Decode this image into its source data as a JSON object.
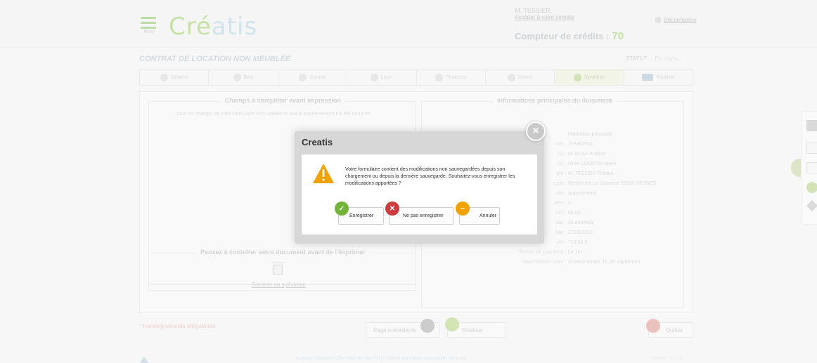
{
  "header": {
    "menu_label": "Menu",
    "logo_part1": "Cré",
    "logo_part2": "atis",
    "user_name": "M. TESSIER,",
    "account_link": "Accéder à votre compte",
    "logout_label": "Déconnexion",
    "credits_label": "Compteur de crédits :",
    "credits_value": "70"
  },
  "document": {
    "title": "CONTRAT DE LOCATION NON MEUBLÉE",
    "status_label": "STATUT",
    "status_value": "... En cours..."
  },
  "tabs": [
    {
      "label": "Général",
      "active": false
    },
    {
      "label": "Bien",
      "active": false
    },
    {
      "label": "Contrat",
      "active": false
    },
    {
      "label": "Loyer",
      "active": false
    },
    {
      "label": "Finances",
      "active": false
    },
    {
      "label": "Divers",
      "active": false
    },
    {
      "label": "Synthèse",
      "active": true
    },
    {
      "label": "Finaliser",
      "active": false
    }
  ],
  "left_panel": {
    "legend": "Champs à compléter avant impression",
    "note": "Tous les champs de votre formulaire sont valides et aucun avertissement n'a été remonté."
  },
  "print_panel": {
    "legend": "Pensez à contrôler votre document avant de l'imprimer",
    "specimen_label": "Spécimen",
    "generate_link": "Générer un spécimen"
  },
  "right_panel": {
    "legend": "Informations principales du document",
    "rows": [
      {
        "label": "",
        "value": "Habitation principale"
      },
      {
        "label": "ure :",
        "value": "27/08/2018"
      },
      {
        "label": "(s) :",
        "value": "M. RUAZ Arnaud"
      },
      {
        "label": "(s) :",
        "value": "Mme COURTIN Marie"
      },
      {
        "label": "ant :",
        "value": "M. TESSIER Thibaut"
      },
      {
        "label": "esse :",
        "value": "Résidence La Cézanne 35000 RENNES"
      },
      {
        "label": "ure :",
        "value": "Appartement"
      },
      {
        "label": "ales :",
        "value": "4"
      },
      {
        "label": "m²) :",
        "value": "65,00"
      },
      {
        "label": "bail :",
        "value": "36 année(s)"
      },
      {
        "label": "bail :",
        "value": "27/08/2018"
      },
      {
        "label": "yer :",
        "value": "710,00 €"
      },
      {
        "label": "Termes de paiement :",
        "value": "Le 1er"
      },
      {
        "label": "Date révision loyer :",
        "value": "Chaque année, le 1er septembre"
      }
    ]
  },
  "footer": {
    "required_note": "* Renseignements obligatoires",
    "prev_label": "Page précédente",
    "next_label": "Finaliser",
    "quit_label": "Quitter",
    "links": "A propos | Contacts | CGV | Plan du site | FAQ | Tableau des indices | Documents mis à jour",
    "version": "Version : 3.2.15"
  },
  "modal": {
    "title": "Creatis",
    "message": "Votre formulaire contient des modifications non sauvegardées depuis son chargement ou depuis la dernière sauvegarde. Souhaitez-vous enregistrer les modifications apportées ?",
    "save_label": "Enregistrer",
    "nosave_label": "Ne pas enregistrer",
    "cancel_label": "Annuler",
    "close_glyph": "×"
  },
  "colors": {
    "brand_green": "#8dc44a",
    "brand_blue": "#9ec8d8",
    "warning": "#f0a300",
    "danger": "#cf3b3b"
  }
}
